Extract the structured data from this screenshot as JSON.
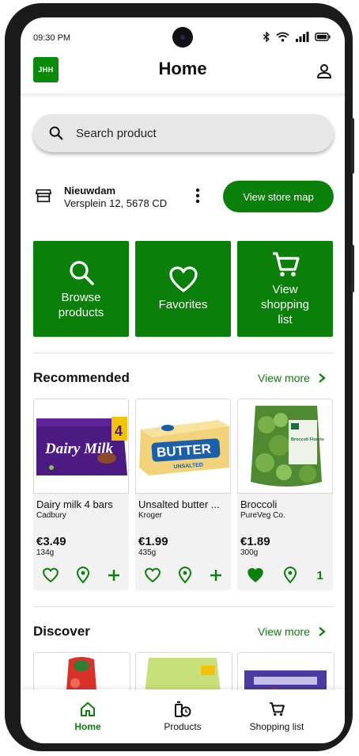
{
  "status_bar": {
    "time": "09:30 PM"
  },
  "header": {
    "logo_text": "JHH",
    "title": "Home"
  },
  "search": {
    "placeholder": "Search product"
  },
  "store": {
    "name": "Nieuwdam",
    "address": "Versplein 12, 5678 CD",
    "map_button": "View store map"
  },
  "quick_actions": [
    {
      "label": "Browse products",
      "icon": "search-icon"
    },
    {
      "label": "Favorites",
      "icon": "heart-icon"
    },
    {
      "label": "View shopping list",
      "icon": "shopping-cart-icon"
    }
  ],
  "recommended": {
    "title": "Recommended",
    "view_more": "View more",
    "products": [
      {
        "name": "Dairy milk 4 bars",
        "brand": "Cadbury",
        "price": "€3.49",
        "weight": "134g",
        "favorite": false,
        "quantity": null,
        "image_text": "Dairy Milk",
        "badge": "4"
      },
      {
        "name": "Unsalted butter ...",
        "brand": "Kroger",
        "price": "€1.99",
        "weight": "435g",
        "favorite": false,
        "quantity": null,
        "image_text": "BUTTER",
        "image_subtext": "UNSALTED"
      },
      {
        "name": "Broccoli",
        "brand": "PureVeg Co.",
        "price": "€1.89",
        "weight": "300g",
        "favorite": true,
        "quantity": "1",
        "image_text": "Broccoli Florets"
      }
    ]
  },
  "discover": {
    "title": "Discover",
    "view_more": "View more"
  },
  "bottom_nav": [
    {
      "label": "Home",
      "icon": "home-icon",
      "active": true
    },
    {
      "label": "Products",
      "icon": "products-icon",
      "active": false
    },
    {
      "label": "Shopping list",
      "icon": "shopping-cart-icon",
      "active": false
    }
  ],
  "colors": {
    "accent": "#0a800a",
    "card_bg": "#f2f2f2",
    "search_bg": "#e7e7e7"
  }
}
